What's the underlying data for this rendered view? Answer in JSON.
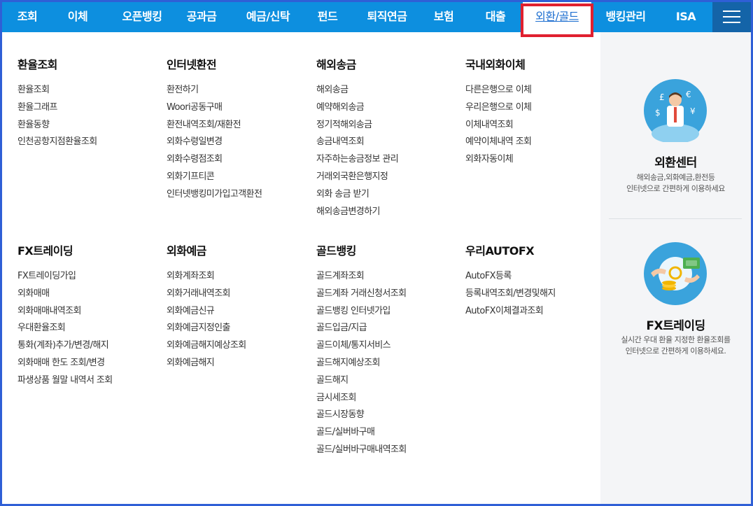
{
  "nav": {
    "items": [
      "조회",
      "이체",
      "오픈뱅킹",
      "공과금",
      "예금/신탁",
      "펀드",
      "퇴직연금",
      "보험",
      "대출",
      "외환/골드",
      "뱅킹관리",
      "ISA"
    ],
    "active": "외환/골드",
    "menu_icon": "hamburger-menu-icon"
  },
  "sections": [
    {
      "title": "환율조회",
      "links": [
        "환율조회",
        "환율그래프",
        "환율동향",
        "인천공항지점환율조회"
      ]
    },
    {
      "title": "인터넷환전",
      "links": [
        "환전하기",
        "Woori공동구매",
        "환전내역조회/재환전",
        "외화수령일변경",
        "외화수령점조회",
        "외화기프티콘",
        "인터넷뱅킹미가입고객환전"
      ]
    },
    {
      "title": "해외송금",
      "links": [
        "해외송금",
        "예약해외송금",
        "정기적해외송금",
        "송금내역조회",
        "자주하는송금정보 관리",
        "거래외국환은행지정",
        "외화 송금 받기",
        "해외송금변경하기"
      ]
    },
    {
      "title": "국내외화이체",
      "links": [
        "다른은행으로 이체",
        "우리은행으로 이체",
        "이체내역조회",
        "예약이체내역 조회",
        "외화자동이체"
      ]
    },
    {
      "title": "FX트레이딩",
      "links": [
        "FX트레이딩가입",
        "외화매매",
        "외화매매내역조회",
        "우대환율조회",
        "통화(계좌)추가/변경/해지",
        "외화매매 한도 조회/변경",
        "파생상품 월말 내역서 조회"
      ]
    },
    {
      "title": "외화예금",
      "links": [
        "외화계좌조회",
        "외화거래내역조회",
        "외화예금신규",
        "외화예금지정인출",
        "외화예금해지예상조회",
        "외화예금해지"
      ]
    },
    {
      "title": "골드뱅킹",
      "links": [
        "골드계좌조회",
        "골드계좌 거래신청서조회",
        "골드뱅킹 인터넷가입",
        "골드입금/지급",
        "골드이체/통지서비스",
        "골드해지예상조회",
        "골드해지",
        "금시세조회",
        "골드시장동향",
        "골드/실버바구매",
        "골드/실버바구매내역조회"
      ]
    },
    {
      "title": "우리AUTOFX",
      "links": [
        "AutoFX등록",
        "등록내역조회/변경및해지",
        "AutoFX이체결과조회"
      ]
    }
  ],
  "side": {
    "panel1": {
      "title": "외환센터",
      "desc_line1": "해외송금,외화예금,환전등",
      "desc_line2": "인터넷으로 간편하게 이용하세요",
      "icon": "currency-businessman-icon"
    },
    "panel2": {
      "title": "FX트레이딩",
      "desc_line1": "실시간 우대 환율 지정한 환율조회를",
      "desc_line2": "인터넷으로 간편하게 이용하세요.",
      "icon": "money-exchange-icon"
    }
  },
  "colors": {
    "nav_bg": "#0d8fdf",
    "nav_menu_bg": "#1464a8",
    "active_outline": "#e0202f",
    "frame": "#2f5fd6",
    "side_bg": "#f4f5f7"
  }
}
